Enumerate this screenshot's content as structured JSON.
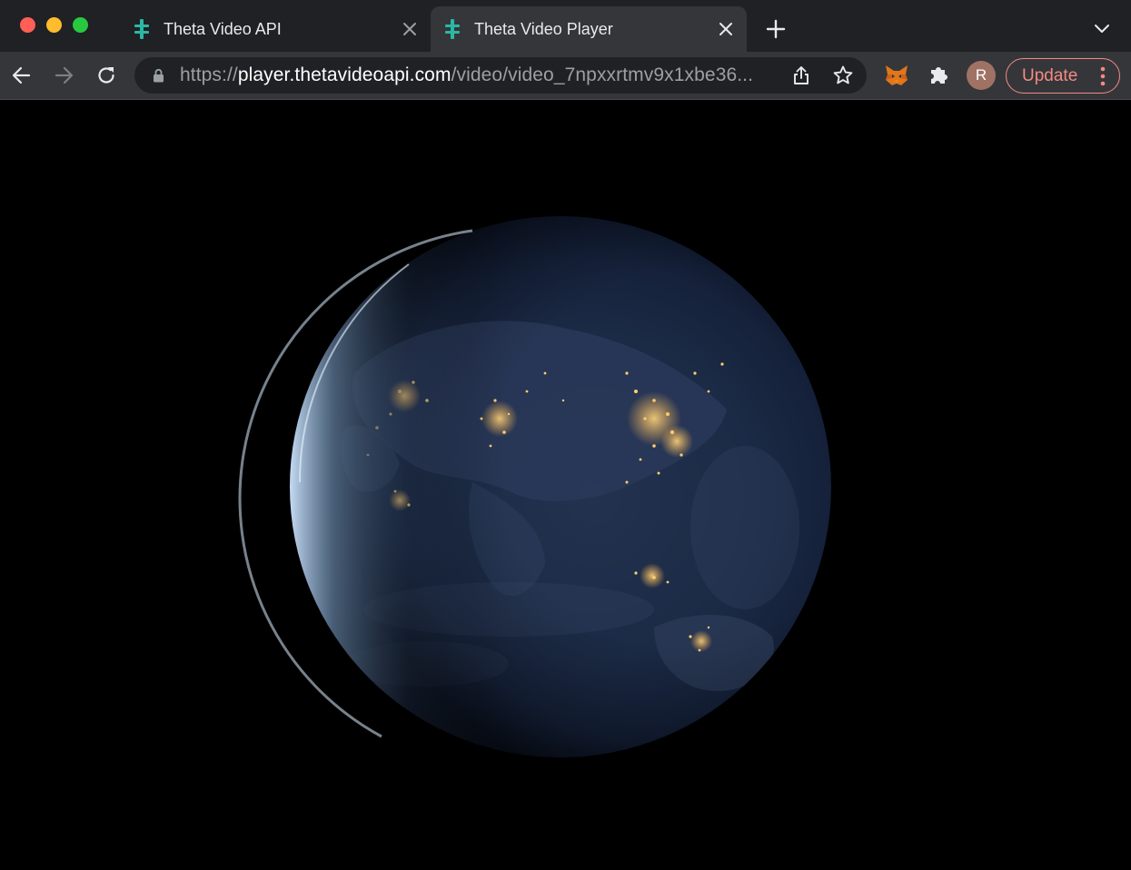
{
  "window": {
    "traffic_lights": [
      "close",
      "minimize",
      "maximize"
    ]
  },
  "tabs": [
    {
      "title": "Theta Video API",
      "favicon": "theta-logo-icon",
      "active": false
    },
    {
      "title": "Theta Video Player",
      "favicon": "theta-logo-icon",
      "active": true
    }
  ],
  "toolbar": {
    "url_scheme": "https://",
    "url_host": "player.thetavideoapi.com",
    "url_path": "/video/video_7npxxrtmv9x1xbe36...",
    "avatar_initial": "R",
    "update_label": "Update"
  },
  "colors": {
    "theta_accent": "#2ab8a5",
    "update_accent": "#f28b82"
  },
  "content": {
    "video_subject": "earth-at-night"
  }
}
